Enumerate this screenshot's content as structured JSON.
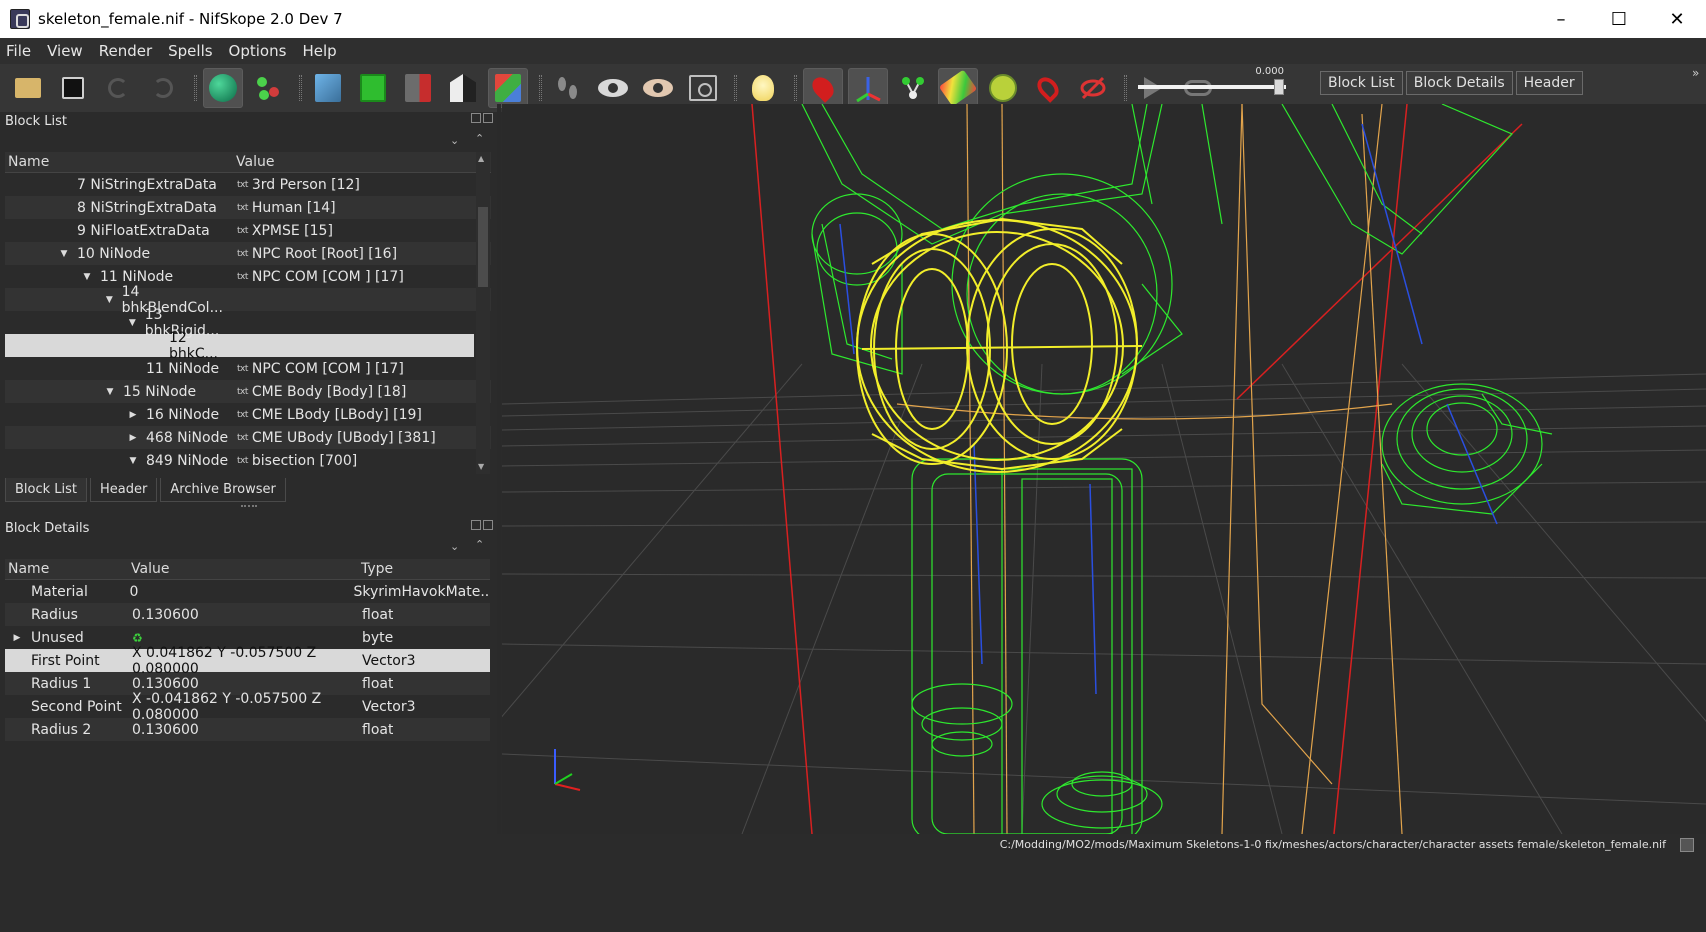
{
  "window": {
    "title": "skeleton_female.nif - NifSkope 2.0 Dev 7",
    "controls": [
      "minimize",
      "maximize",
      "close"
    ]
  },
  "menu": [
    "File",
    "View",
    "Render",
    "Spells",
    "Options",
    "Help"
  ],
  "toolbar": {
    "slider_value": "0.000",
    "tabs": [
      "Block List",
      "Block Details",
      "Header"
    ],
    "more": "»"
  },
  "block_list": {
    "title": "Block List",
    "columns": [
      "Name",
      "Value"
    ],
    "rows": [
      {
        "name": "7 NiStringExtraData",
        "value": "3rd Person [12]"
      },
      {
        "name": "8 NiStringExtraData",
        "value": "Human [14]"
      },
      {
        "name": "9 NiFloatExtraData",
        "value": "XPMSE [15]"
      },
      {
        "name": "10 NiNode",
        "value": "NPC Root [Root] [16]"
      },
      {
        "name": "11 NiNode",
        "value": "NPC COM [COM ] [17]"
      },
      {
        "name": "14 bhkBlendCol...",
        "value": ""
      },
      {
        "name": "13 bhkRigid...",
        "value": ""
      },
      {
        "name": "12 bhkC...",
        "value": ""
      },
      {
        "name": "11 NiNode",
        "value": "NPC COM [COM ] [17]"
      },
      {
        "name": "15 NiNode",
        "value": "CME Body [Body] [18]"
      },
      {
        "name": "16 NiNode",
        "value": "CME LBody [LBody] [19]"
      },
      {
        "name": "468 NiNode",
        "value": "CME UBody [UBody] [381]"
      },
      {
        "name": "849 NiNode",
        "value": "bisection [700]"
      }
    ],
    "text_icon": "txt"
  },
  "bottom_tabs": [
    "Block List",
    "Header",
    "Archive Browser"
  ],
  "block_details": {
    "title": "Block Details",
    "columns": [
      "Name",
      "Value",
      "Type"
    ],
    "rows": [
      {
        "name": "Material",
        "value": "0",
        "type": "SkyrimHavokMate..."
      },
      {
        "name": "Radius",
        "value": "0.130600",
        "type": "float"
      },
      {
        "name": "Unused",
        "value": "",
        "type": "byte"
      },
      {
        "name": "First Point",
        "value": "X 0.041862 Y -0.057500 Z 0.080000",
        "type": "Vector3"
      },
      {
        "name": "Radius 1",
        "value": "0.130600",
        "type": "float"
      },
      {
        "name": "Second Point",
        "value": "X -0.041862 Y -0.057500 Z 0.080000",
        "type": "Vector3"
      },
      {
        "name": "Radius 2",
        "value": "0.130600",
        "type": "float"
      }
    ]
  },
  "status": {
    "path": "C:/Modding/MO2/mods/Maximum Skeletons-1-0 fix/meshes/actors/character/character assets female/skeleton_female.nif"
  },
  "colors": {
    "wire_green": "#2ee82e",
    "wire_yellow": "#f2ee2a",
    "wire_orange": "#e0a64a",
    "axis_red": "#e02020",
    "axis_blue": "#2a4fe0"
  }
}
